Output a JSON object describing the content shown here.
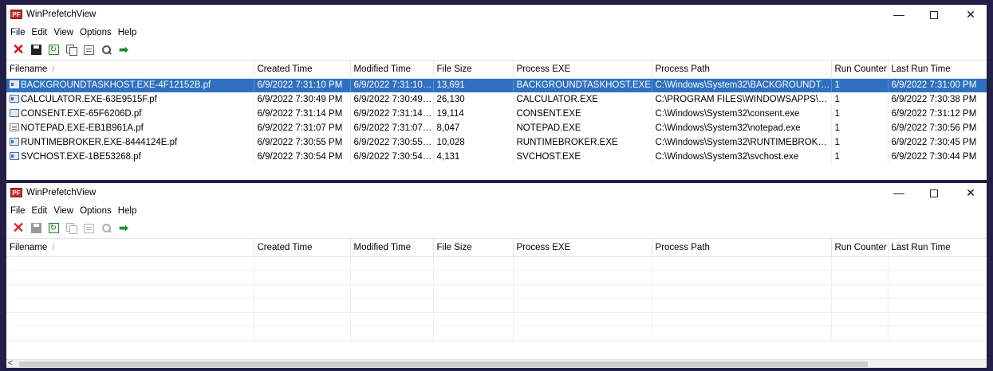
{
  "windows": [
    {
      "title": "WinPrefetchView",
      "app_icon": "PF",
      "menu": [
        "File",
        "Edit",
        "View",
        "Options",
        "Help"
      ],
      "toolbar_enabled": true,
      "columns": [
        "Filename",
        "Created Time",
        "Modified Time",
        "File Size",
        "Process EXE",
        "Process Path",
        "Run Counter",
        "Last Run Time"
      ],
      "sort_indicator": "/",
      "rows": [
        {
          "icon": "app-icon",
          "selected": true,
          "cells": [
            "BACKGROUNDTASKHOST.EXE-4F12152B.pf",
            "6/9/2022 7:31:10 PM",
            "6/9/2022 7:31:10 ...",
            "13,691",
            "BACKGROUNDTASKHOST.EXE",
            "C:\\Windows\\System32\\BACKGROUNDTA...",
            "1",
            "6/9/2022 7:31:00 PM"
          ]
        },
        {
          "icon": "app-icon",
          "selected": false,
          "cells": [
            "CALCULATOR.EXE-63E9515F.pf",
            "6/9/2022 7:30:49 PM",
            "6/9/2022 7:30:49 ...",
            "26,130",
            "CALCULATOR.EXE",
            "C:\\PROGRAM FILES\\WINDOWSAPPS\\MIC...",
            "1",
            "6/9/2022 7:30:38 PM"
          ]
        },
        {
          "icon": "window-icon",
          "selected": false,
          "cells": [
            "CONSENT.EXE-65F6206D.pf",
            "6/9/2022 7:31:14 PM",
            "6/9/2022 7:31:14 ...",
            "19,114",
            "CONSENT.EXE",
            "C:\\Windows\\System32\\consent.exe",
            "1",
            "6/9/2022 7:31:12 PM"
          ]
        },
        {
          "icon": "notepad-icon",
          "selected": false,
          "cells": [
            "NOTEPAD.EXE-EB1B961A.pf",
            "6/9/2022 7:31:07 PM",
            "6/9/2022 7:31:07 ...",
            "8,047",
            "NOTEPAD.EXE",
            "C:\\Windows\\System32\\notepad.exe",
            "1",
            "6/9/2022 7:30:56 PM"
          ]
        },
        {
          "icon": "app-icon",
          "selected": false,
          "cells": [
            "RUNTIMEBROKER.EXE-8444124E.pf",
            "6/9/2022 7:30:55 PM",
            "6/9/2022 7:30:55 ...",
            "10,028",
            "RUNTIMEBROKER.EXE",
            "C:\\Windows\\System32\\RUNTIMEBROKER...",
            "1",
            "6/9/2022 7:30:45 PM"
          ]
        },
        {
          "icon": "app-icon",
          "selected": false,
          "cells": [
            "SVCHOST.EXE-1BE53268.pf",
            "6/9/2022 7:30:54 PM",
            "6/9/2022 7:30:54 ...",
            "4,131",
            "SVCHOST.EXE",
            "C:\\Windows\\System32\\svchost.exe",
            "1",
            "6/9/2022 7:30:44 PM"
          ]
        }
      ]
    },
    {
      "title": "WinPrefetchView",
      "app_icon": "PF",
      "menu": [
        "File",
        "Edit",
        "View",
        "Options",
        "Help"
      ],
      "toolbar_enabled": false,
      "columns": [
        "Filename",
        "Created Time",
        "Modified Time",
        "File Size",
        "Process EXE",
        "Process Path",
        "Run Counter",
        "Last Run Time"
      ],
      "sort_indicator": "/",
      "rows": [],
      "empty_row_count": 6,
      "scroll_left_arrow": "<"
    }
  ],
  "toolbar_icons": [
    "delete-icon",
    "save-icon",
    "refresh-icon",
    "copy-icon",
    "properties-icon",
    "find-icon",
    "exit-icon"
  ],
  "colors": {
    "selection": "#2f70c2",
    "desktop": "#231f47",
    "delete": "#dd1111"
  }
}
